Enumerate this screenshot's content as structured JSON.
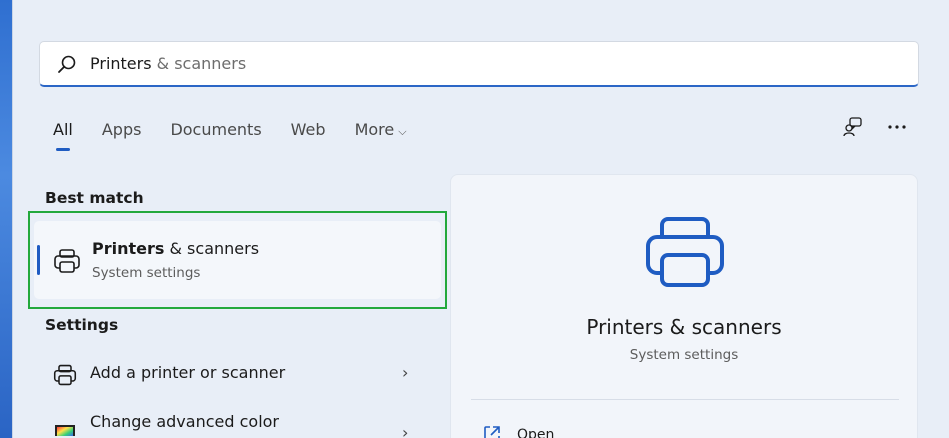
{
  "search": {
    "query_main": "Printers",
    "query_rest": " & scanners"
  },
  "tabs": [
    {
      "label": "All",
      "active": true
    },
    {
      "label": "Apps"
    },
    {
      "label": "Documents"
    },
    {
      "label": "Web"
    },
    {
      "label": "More",
      "chevron": "⌵"
    }
  ],
  "top_icons": [
    "feedback-icon",
    "more-options-icon"
  ],
  "best_match": {
    "heading": "Best match",
    "title_bold": "Printers",
    "title_rest": " & scanners",
    "subtitle": "System settings",
    "icon": "printer-icon"
  },
  "settings": {
    "heading": "Settings",
    "items": [
      {
        "label": "Add a printer or scanner",
        "icon": "printer-icon",
        "chevron": "›"
      },
      {
        "label": "Change advanced color",
        "icon": "color-settings-icon",
        "chevron": "›"
      }
    ]
  },
  "detail": {
    "title": "Printers & scanners",
    "subtitle": "System settings",
    "icon": "printer-large-icon",
    "actions": [
      {
        "label": "Open",
        "icon": "open-external-icon"
      }
    ]
  },
  "colors": {
    "accent": "#1f5cc2",
    "highlight_border": "#22a83c"
  }
}
